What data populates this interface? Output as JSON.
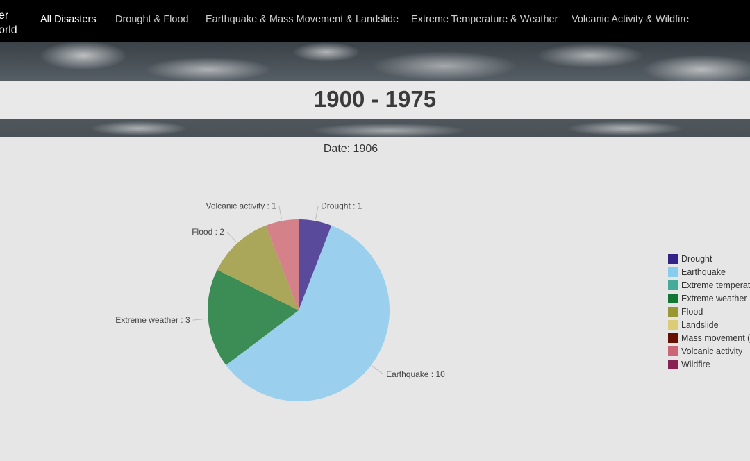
{
  "nav": {
    "brand_line1": "er",
    "brand_line2": "orld",
    "items": [
      {
        "label": "All Disasters",
        "active": true
      },
      {
        "label": "Drought & Flood",
        "active": false
      },
      {
        "label": "Earthquake & Mass Movement & Landslide",
        "active": false
      },
      {
        "label": "Extreme Temperature & Weather",
        "active": false
      },
      {
        "label": "Volcanic Activity & Wildfire",
        "active": false
      }
    ]
  },
  "header": {
    "range_title": "1900 - 1975"
  },
  "chart_data": {
    "type": "pie",
    "title": "Date: 1906",
    "slices": [
      {
        "label": "Drought",
        "value": 1,
        "color": "#5a4a9c"
      },
      {
        "label": "Earthquake",
        "value": 10,
        "color": "#9ad0ee"
      },
      {
        "label": "Extreme weather",
        "value": 3,
        "color": "#3c8c55"
      },
      {
        "label": "Flood",
        "value": 2,
        "color": "#aba75a"
      },
      {
        "label": "Volcanic activity",
        "value": 1,
        "color": "#d4818a"
      }
    ],
    "legend": [
      {
        "label": "Drought",
        "color": "#332288"
      },
      {
        "label": "Earthquake",
        "color": "#88ccee"
      },
      {
        "label": "Extreme temperature",
        "color": "#44aa99"
      },
      {
        "label": "Extreme weather",
        "color": "#117733"
      },
      {
        "label": "Flood",
        "color": "#999933"
      },
      {
        "label": "Landslide",
        "color": "#ddcc77"
      },
      {
        "label": "Mass movement (dry)",
        "color": "#661100"
      },
      {
        "label": "Volcanic activity",
        "color": "#cc6677"
      },
      {
        "label": "Wildfire",
        "color": "#882255"
      }
    ],
    "legend_position": "right"
  }
}
